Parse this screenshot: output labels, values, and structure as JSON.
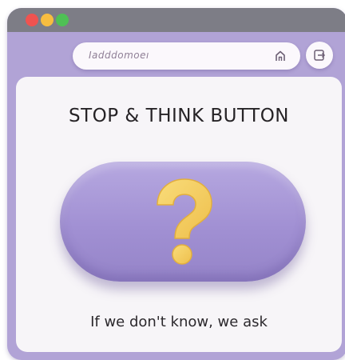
{
  "window": {
    "controls": [
      {
        "name": "close",
        "color": "#ef5350"
      },
      {
        "name": "minimize",
        "color": "#f7bd3f"
      },
      {
        "name": "maximize",
        "color": "#4fc055"
      }
    ]
  },
  "addressbar": {
    "url": "Iadddomoeı",
    "icon": "home-icon"
  },
  "side_button": {
    "icon": "exit-icon"
  },
  "content": {
    "heading": "STOP & THINK BUTTON",
    "button_icon": "question-mark-icon",
    "button_icon_color": "#f4cd62",
    "caption": "If we don't know, we ask"
  }
}
